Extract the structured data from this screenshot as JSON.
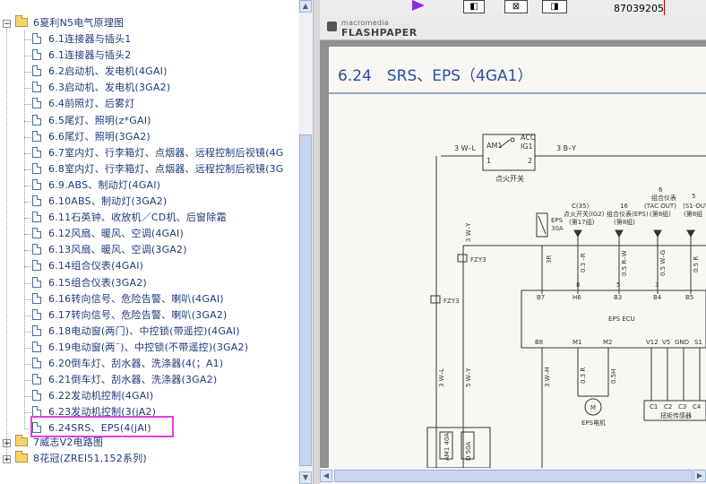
{
  "tree": {
    "folders": [
      {
        "label": "6夏利N5电气原理图",
        "expanded": true
      },
      {
        "label": "7威志V2电路图",
        "expanded": false
      },
      {
        "label": "8花冠(ZREI51,152系列)",
        "expanded": false
      }
    ],
    "items": [
      "6.1连接器与插头1",
      "6.1连接器与插头2",
      "6.2启动机、发电机(4GAI)",
      "6.3启动机、发电机(3GA2)",
      "6.4前照灯、后雾灯",
      "6.5尾灯、照明(z*GAI)",
      "6.6尾灯、照明(3GA2)",
      "6.7室内灯、行李箱灯、点烟器、远程控制后视镜(4G",
      "6.8室内灯、行李箱灯、点烟器、远程控制后视镜(3G",
      "6.9.ABS、制动灯(4GAI)",
      "6.10ABS、制动灯(3GA2)",
      "6.11石英钟、收放机／CD机、后窗除霜",
      "6.12风扇、暖风、空调(4GAI)",
      "6.13风扇、暖风、空调(3GA2)",
      "6.14组合仪表(4GAI)",
      "6.15组合仪表(3GA2)",
      "6.16转向信号、危险告警、喇叭(4GAI)",
      "6.17转向信号、危险告警、喇叭(3GA2)",
      "6.18电动窗(两门)、中控锁(带遥控)(4GAI)",
      "6.19电动窗(两¨)、中控锁(不带遥控)(3GA2)",
      "6.20倒车灯、刮水器、洗涤器(4(；A1)",
      "6.21倒车灯、刮水器、洗涤器(3GA2)",
      "6.22发动机控制(4GAI)",
      "6.23发动机控制(3(jA2)",
      "6.24SRS、EPS(4(jAl)"
    ],
    "selected_index": 24
  },
  "viewer": {
    "page_number": "87039205",
    "logo_small": "macromedia",
    "logo": "FLASHPAPER",
    "doc_title": "6.24　SRS、EPS（4GA1）",
    "diagram": {
      "labels": {
        "w1": "3 W–L",
        "am1": "AM1",
        "acc": "ACC",
        "ig1": "IG1",
        "n1": "1",
        "n2": "2",
        "n3": "3",
        "bry": "3 B–Y",
        "switch": "点火开关",
        "c35": "C(35)",
        "ign_sw_ig2": "点火开关(IG2)",
        "ign_sw_ig2b": "(第17组)",
        "g16": "16",
        "combo_eps": "组合仪表(EPS)",
        "combo_eps2": "(第8组)",
        "g6": "6",
        "combo_tac": "组合仪表",
        "combo_tac2": "(TAC OUT)",
        "combo_tac3": "(第8组)",
        "g5": "5",
        "s1": "(S1-OUT)",
        "s1b": "(第8组",
        "eps_fuse": "EPS",
        "eps_fuse2": "30A",
        "wy": "3 W–Y",
        "fzy3a": "FZY3",
        "fzy3b": "FZY3",
        "r3": "3R",
        "r03": "0.3 –R",
        "rw": "0.5 R–W",
        "bwg": "0.5 W–G",
        "rwb": "0.5 R",
        "b7": "B7",
        "h6": "H6",
        "b3": "B3",
        "b4": "B4",
        "b5": "B5",
        "p8": "8",
        "p5": "5",
        "p3": "3",
        "ecu": "EPS ECU",
        "b8": "B8",
        "m1": "M1",
        "m2": "M2",
        "v12": "V12",
        "v5": "V5",
        "gnd": "GND",
        "s1x": "S1",
        "wl": "3 W–L",
        "wy5": "5 W–Y",
        "wh": "3 W–H",
        "r3b": "0.3 R",
        "o5": "0.5H",
        "m": "M",
        "eps_motor": "EPS电机",
        "c1": "C1",
        "c2": "C2",
        "c3": "C3",
        "c4": "C4",
        "torque": "扭矩传感器",
        "am1_40": "AM1 40A",
        "d50": "D 50A"
      }
    }
  }
}
